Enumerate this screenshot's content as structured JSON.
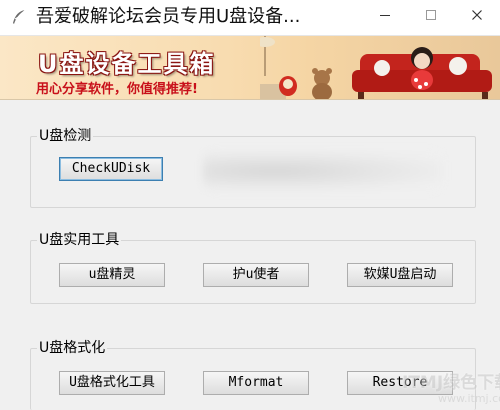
{
  "window": {
    "title": "吾爱破解论坛会员专用U盘设备...",
    "app_icon": "feather-icon",
    "controls": [
      "minimize-icon",
      "maximize-icon",
      "close-icon"
    ]
  },
  "banner": {
    "title": "U盘设备工具箱",
    "subtitle": "用心分享软件，你值得推荐!",
    "colors": {
      "title_outline": "#8a1512",
      "subtitle": "#c8101a",
      "sofa": "#c3241d"
    }
  },
  "groups": [
    {
      "label": "U盘检测",
      "buttons": [
        {
          "label": "CheckUDisk"
        }
      ]
    },
    {
      "label": "U盘实用工具",
      "buttons": [
        {
          "label": "u盘精灵"
        },
        {
          "label": "护u使者"
        },
        {
          "label": "软媒U盘启动"
        }
      ]
    },
    {
      "label": "U盘格式化",
      "buttons": [
        {
          "label": "U盘格式化工具"
        },
        {
          "label": "Mformat"
        },
        {
          "label": "Restore"
        }
      ]
    }
  ],
  "watermark": {
    "text": "ITMJ绿色下载",
    "url": "www.itmj.com"
  }
}
